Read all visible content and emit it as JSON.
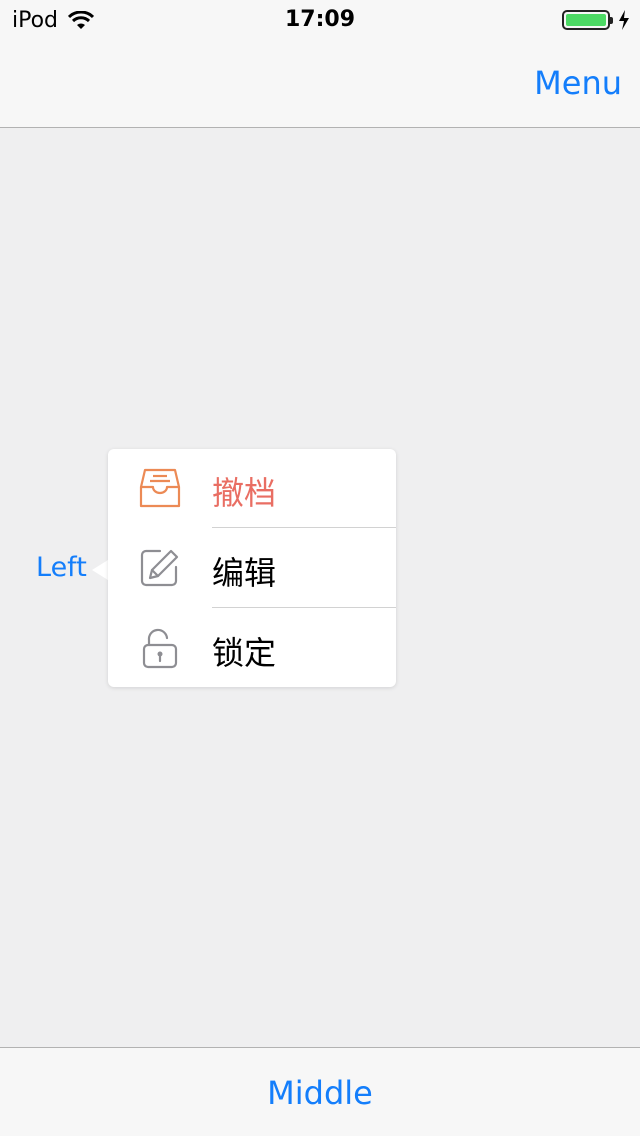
{
  "status_bar": {
    "carrier": "iPod",
    "time": "17:09",
    "battery_level": 1.0
  },
  "nav": {
    "right_button": "Menu"
  },
  "content": {
    "left_label": "Left"
  },
  "popover_menu": {
    "items": [
      {
        "label": "撤档",
        "icon": "archive-tray-icon",
        "color": "#e96e63"
      },
      {
        "label": "编辑",
        "icon": "edit-pencil-icon",
        "color": "#000000"
      },
      {
        "label": "锁定",
        "icon": "lock-open-icon",
        "color": "#000000"
      }
    ]
  },
  "toolbar": {
    "middle_button": "Middle"
  },
  "colors": {
    "accent": "#147efb",
    "archive_icon": "#ec8a55",
    "battery": "#4cd964"
  }
}
